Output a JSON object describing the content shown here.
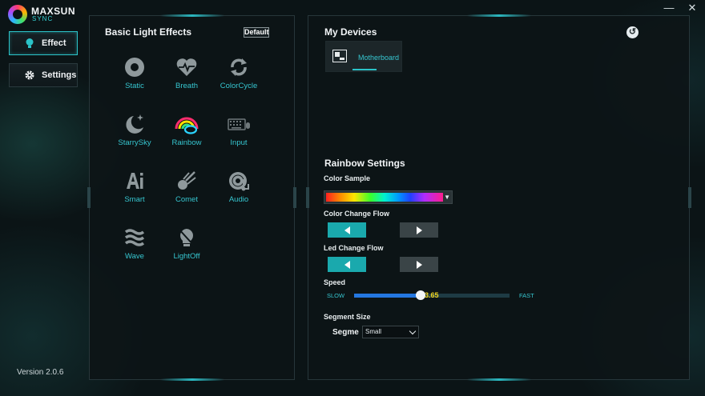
{
  "app": {
    "brand": "MAXSUN",
    "sub_brand": "SYNC",
    "version": "Version 2.0.6",
    "minimize_symbol": "—",
    "close_symbol": "✕"
  },
  "nav": {
    "effect": "Effect",
    "settings": "Settings",
    "active": "Effect"
  },
  "basic_light_effects": {
    "title": "Basic Light Effects",
    "default_button": "Default",
    "items": [
      {
        "label": "Static",
        "icon": "static-icon"
      },
      {
        "label": "Breath",
        "icon": "heartbeat-icon"
      },
      {
        "label": "ColorCycle",
        "icon": "cycle-icon"
      },
      {
        "label": "StarrySky",
        "icon": "moon-stars-icon"
      },
      {
        "label": "Rainbow",
        "icon": "rainbow-icon",
        "selected": true
      },
      {
        "label": "Input",
        "icon": "keyboard-icon"
      },
      {
        "label": "Smart",
        "icon": "ai-icon"
      },
      {
        "label": "Comet",
        "icon": "comet-icon"
      },
      {
        "label": "Audio",
        "icon": "audio-icon"
      },
      {
        "label": "Wave",
        "icon": "wave-icon"
      },
      {
        "label": "LightOff",
        "icon": "bulb-off-icon"
      }
    ]
  },
  "my_devices": {
    "title": "My Devices",
    "devices": [
      {
        "label": "Motherboard",
        "icon": "motherboard-icon"
      }
    ],
    "refresh_symbol": "↺"
  },
  "rainbow_settings": {
    "title": "Rainbow Settings",
    "color_sample_label": "Color Sample",
    "color_change_flow_label": "Color Change Flow",
    "led_change_flow_label": "Led Change Flow",
    "color_change_flow_selected": "left",
    "led_change_flow_selected": "left",
    "speed_label": "Speed",
    "speed_slow": "SLOW",
    "speed_fast": "FAST",
    "speed_value": "3.65",
    "speed_fraction": 0.43,
    "segment_size_label": "Segment Size",
    "segme_label": "Segme",
    "segment_size_value": "Small"
  },
  "colors": {
    "accent": "#2bc3c8",
    "label_cyan": "#36c6d0",
    "slider_blue": "#2477e0",
    "value_yellow": "#f2d21a"
  }
}
